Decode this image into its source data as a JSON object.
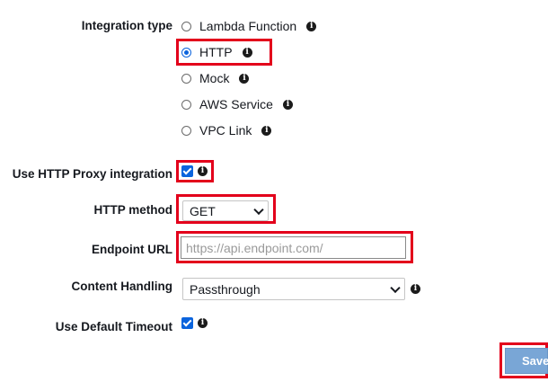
{
  "integration_type": {
    "label": "Integration type",
    "selected": "HTTP",
    "options": [
      {
        "label": "Lambda Function",
        "info_icon": "info-icon"
      },
      {
        "label": "HTTP",
        "info_icon": "info-icon"
      },
      {
        "label": "Mock",
        "info_icon": "info-icon"
      },
      {
        "label": "AWS Service",
        "info_icon": "info-icon"
      },
      {
        "label": "VPC Link",
        "info_icon": "info-icon"
      }
    ]
  },
  "proxy_integration": {
    "label": "Use HTTP Proxy integration",
    "checked": true
  },
  "http_method": {
    "label": "HTTP method",
    "value": "GET"
  },
  "endpoint_url": {
    "label": "Endpoint URL",
    "value": "",
    "placeholder": "https://api.endpoint.com/"
  },
  "content_handling": {
    "label": "Content Handling",
    "value": "Passthrough"
  },
  "default_timeout": {
    "label": "Use Default Timeout",
    "checked": true
  },
  "save_button": {
    "label": "Save"
  },
  "info_glyph": "i",
  "colors": {
    "highlight_box": "#e3001b",
    "accent": "#0b64dd",
    "button": "#79a6d6"
  }
}
